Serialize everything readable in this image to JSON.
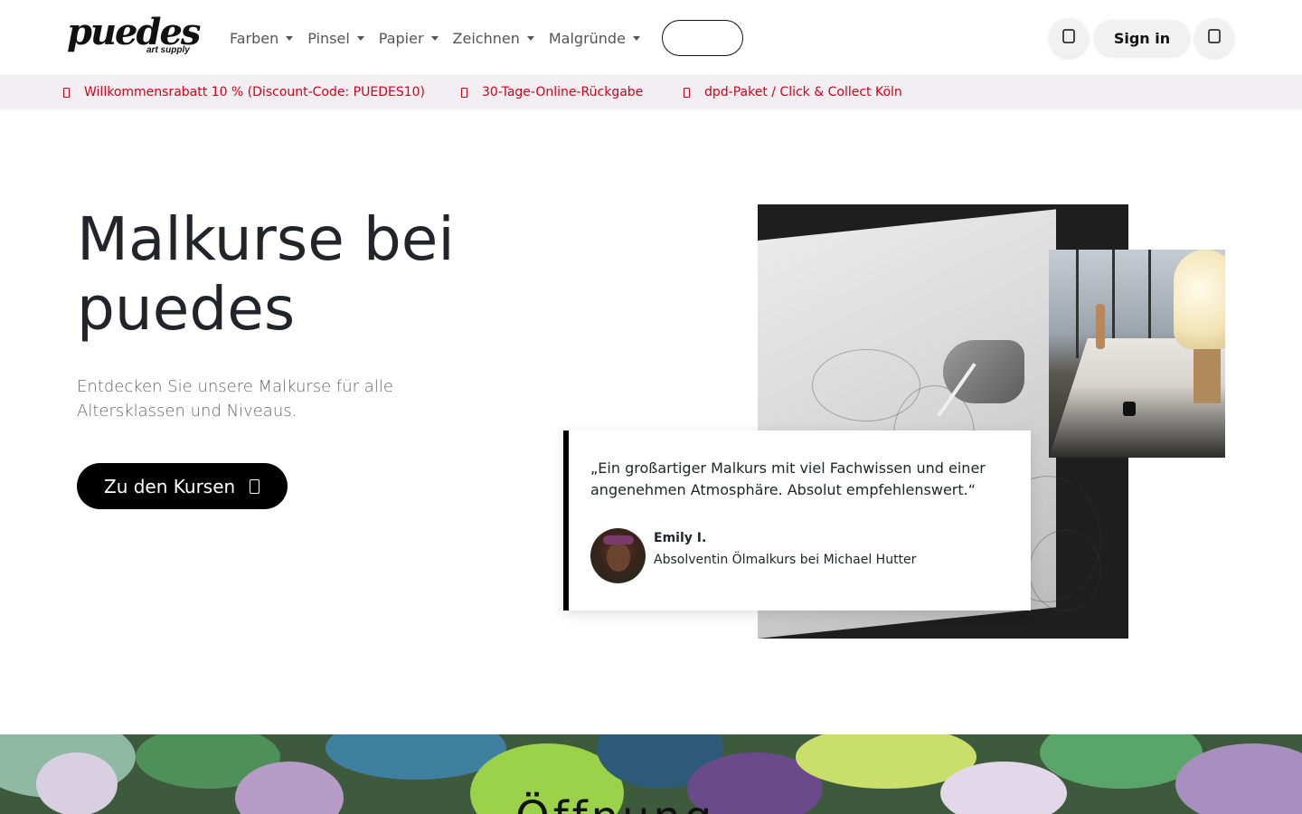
{
  "header": {
    "logo": {
      "word": "puedes",
      "tagline": "art supply"
    },
    "nav": [
      {
        "label": "Farben"
      },
      {
        "label": "Pinsel"
      },
      {
        "label": "Papier"
      },
      {
        "label": "Zeichnen"
      },
      {
        "label": "Malgründe"
      }
    ],
    "search_icon": "search-icon",
    "signin_label": "Sign in",
    "account_icon": "user-icon",
    "cart_icon": "cart-icon"
  },
  "promo": [
    {
      "icon": "tag-icon",
      "text": "Willkommensrabatt 10 % (Discount-Code: PUEDES10)"
    },
    {
      "icon": "return-icon",
      "text": "30-Tage-Online-Rückgabe"
    },
    {
      "icon": "truck-icon",
      "text": "dpd-Paket / Click & Collect Köln"
    }
  ],
  "hero": {
    "title": "Malkurse bei puedes",
    "subtitle": "Entdecken Sie unsere Malkurse für alle Altersklassen und Niveaus.",
    "cta_label": "Zu den Kursen",
    "cta_icon": "arrow-right-icon"
  },
  "testimonial": {
    "quote": "„Ein großartiger Malkurs mit viel Fachwissen und einer angenehmen Atmosphäre. Absolut empfehlenswert.“",
    "author": "Emily I.",
    "role": "Absolventin Ölmalkurs bei Michael Hutter"
  },
  "section_heading_partial": "Öffnung",
  "colors": {
    "accent_red": "#d0021b",
    "promo_bg": "#f2eff2",
    "cta_bg": "#000000",
    "text": "#212529"
  }
}
